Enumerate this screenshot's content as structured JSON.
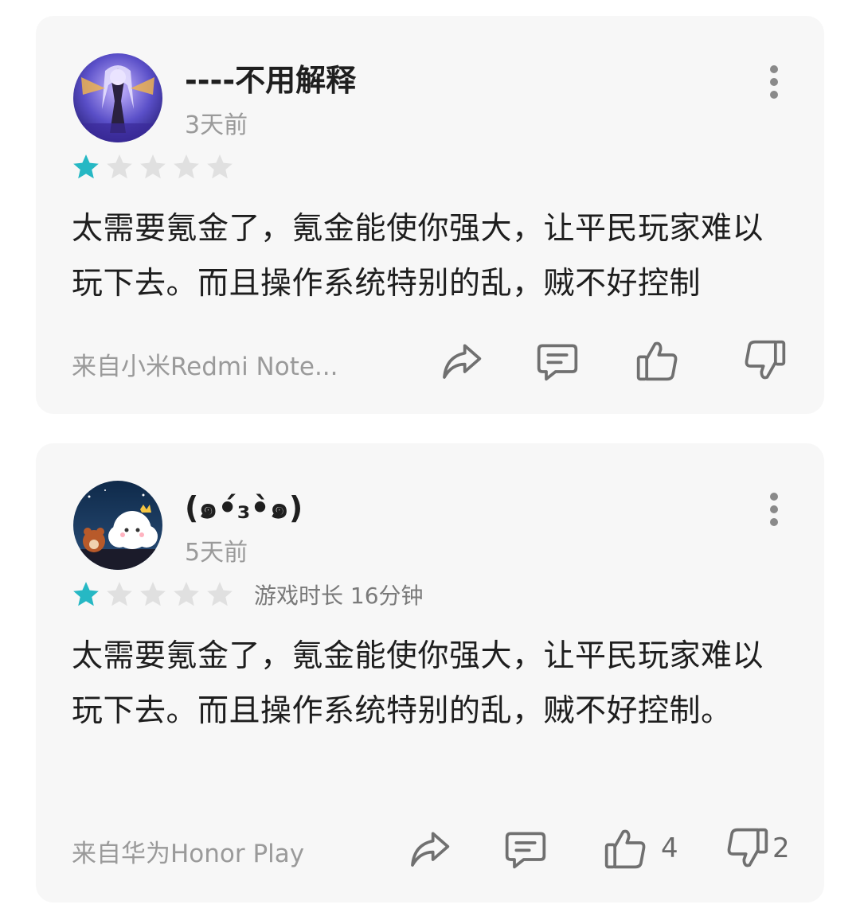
{
  "reviews": [
    {
      "username": "----不用解释",
      "time": "3天前",
      "rating": 1,
      "rating_max": 5,
      "playtime": "",
      "text": "太需要氪金了，氪金能使你强大，让平民玩家难以玩下去。而且操作系统特别的乱，贼不好控制",
      "device": "来自小米Redmi Note...",
      "like_count": "",
      "dislike_count": "",
      "avatar": "anime-character-avatar"
    },
    {
      "username": "(๑•́₃•̀๑)",
      "time": "5天前",
      "rating": 1,
      "rating_max": 5,
      "playtime": "游戏时长 16分钟",
      "text": "太需要氪金了，氪金能使你强大，让平民玩家难以玩下去。而且操作系统特别的乱，贼不好控制。",
      "device": "来自华为Honor Play",
      "like_count": "4",
      "dislike_count": "2",
      "avatar": "cartoon-cloud-avatar"
    }
  ],
  "colors": {
    "star_filled": "#26b8c4",
    "star_empty": "#e0e0e0",
    "icon_stroke": "#707070"
  },
  "icons": {
    "share": "share-icon",
    "comment": "comment-icon",
    "like": "thumbs-up-icon",
    "dislike": "thumbs-down-icon",
    "more": "more-vertical-icon"
  }
}
